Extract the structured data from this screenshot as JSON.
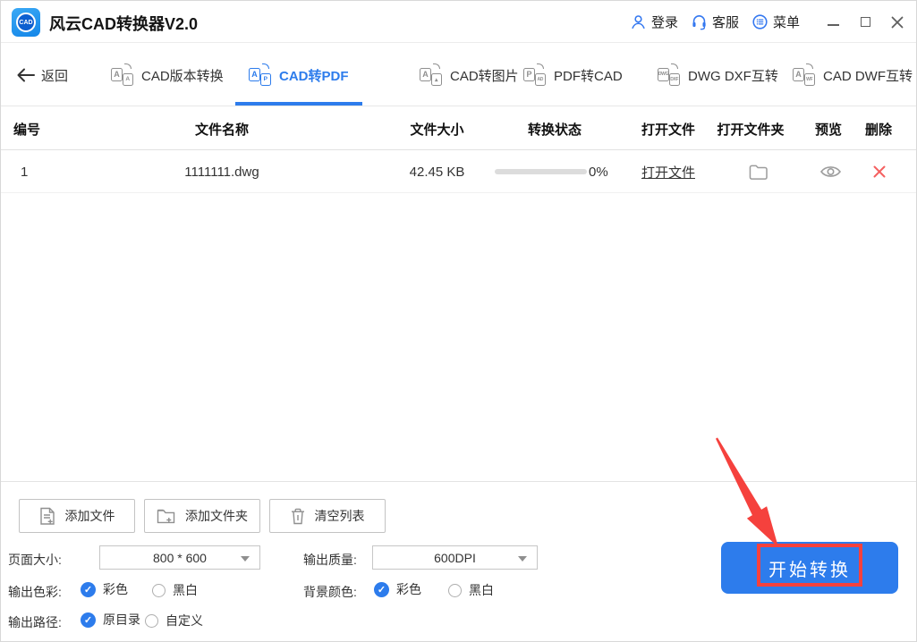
{
  "window": {
    "title": "风云CAD转换器V2.0",
    "logo_text": "CAD",
    "titlebar": {
      "login": "登录",
      "support": "客服",
      "menu": "菜单"
    }
  },
  "nav": {
    "back_label": "返回",
    "tabs": [
      {
        "label": "CAD版本转换",
        "icon_front": "A",
        "icon_back": "A",
        "active": false
      },
      {
        "label": "CAD转PDF",
        "icon_front": "A",
        "icon_back": "P",
        "active": true
      },
      {
        "label": "CAD转图片",
        "icon_front": "A",
        "icon_back": "▴",
        "active": false
      },
      {
        "label": "PDF转CAD",
        "icon_front": "P",
        "icon_back": "AD",
        "active": false
      },
      {
        "label": "DWG DXF互转",
        "icon_front": "DWG",
        "icon_back": "DXF",
        "active": false
      },
      {
        "label": "CAD DWF互转",
        "icon_front": "A",
        "icon_back": "WF",
        "active": false
      }
    ]
  },
  "table": {
    "headers": {
      "index": "编号",
      "filename": "文件名称",
      "filesize": "文件大小",
      "status": "转换状态",
      "open_file": "打开文件",
      "open_folder": "打开文件夹",
      "preview": "预览",
      "delete": "删除"
    },
    "row": {
      "index": "1",
      "filename": "1111111.dwg",
      "filesize": "42.45 KB",
      "progress_percent": 0,
      "progress_label": "0%",
      "open_file_label": "打开文件"
    }
  },
  "actions": {
    "add_file": "添加文件",
    "add_folder": "添加文件夹",
    "clear_list": "清空列表",
    "start_convert": "开始转换"
  },
  "settings": {
    "page_size": {
      "label": "页面大小:",
      "value": "800 * 600"
    },
    "output_quality": {
      "label": "输出质量:",
      "value": "600DPI"
    },
    "output_color": {
      "label": "输出色彩:",
      "opt1": "彩色",
      "opt2": "黑白",
      "checked": "彩色"
    },
    "background_color": {
      "label": "背景颜色:",
      "opt1": "彩色",
      "opt2": "黑白",
      "checked": "彩色"
    },
    "output_path": {
      "label": "输出路径:",
      "opt1": "原目录",
      "opt2": "自定义",
      "checked": "原目录"
    },
    "check_glyph": "✓"
  },
  "colors": {
    "accent_blue": "#2d7cec",
    "titlebar_icon_blue": "#3478f0",
    "annotation_red": "#f5413d",
    "delete_red": "#f56060",
    "icon_gray": "#9c9c9c"
  }
}
